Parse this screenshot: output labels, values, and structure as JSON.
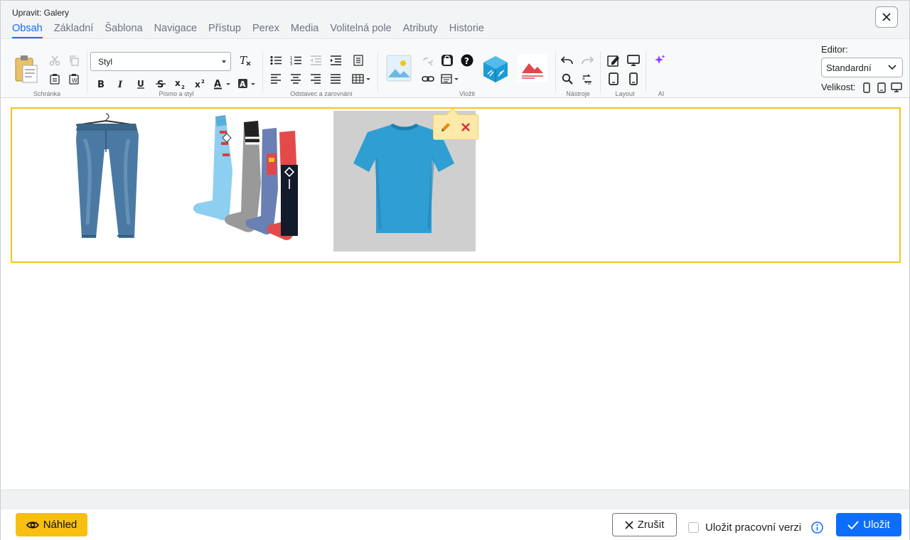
{
  "window": {
    "title": "Upravit: Galery"
  },
  "tabs": [
    {
      "label": "Obsah",
      "active": true
    },
    {
      "label": "Základní"
    },
    {
      "label": "Šablona"
    },
    {
      "label": "Navigace"
    },
    {
      "label": "Přístup"
    },
    {
      "label": "Perex"
    },
    {
      "label": "Media"
    },
    {
      "label": "Volitelná pole"
    },
    {
      "label": "Atributy"
    },
    {
      "label": "Historie"
    }
  ],
  "toolbar": {
    "groups": {
      "clipboard": "Schránka",
      "font": "Písmo a styl",
      "paragraph": "Odstavec a zarovnání",
      "insert": "Vložit",
      "tools": "Nástroje",
      "layout": "Layout",
      "ai": "AI"
    },
    "style_select": "Styl",
    "editor_label": "Editor:",
    "editor_value": "Standardní",
    "size_label": "Velikost:"
  },
  "gallery": {
    "images": [
      {
        "name": "jeans"
      },
      {
        "name": "socks"
      },
      {
        "name": "t-shirt",
        "selected": true
      }
    ]
  },
  "footer": {
    "preview": "Náhled",
    "cancel": "Zrušit",
    "draft_label": "Uložit pracovní verzi",
    "save": "Uložit"
  },
  "colors": {
    "accent": "#0d6efd",
    "preview_btn": "#f7bf11",
    "selection_border": "#f5c518"
  }
}
